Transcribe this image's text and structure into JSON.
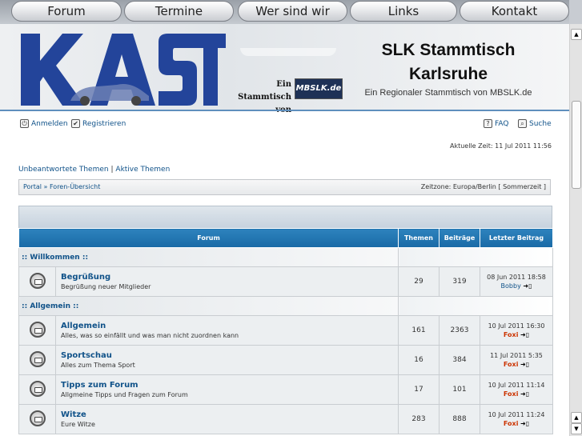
{
  "nav": {
    "tabs": [
      "Forum",
      "Termine",
      "Wer sind wir",
      "Links",
      "Kontakt"
    ]
  },
  "header": {
    "logo_text": "KAST",
    "logo_sub_line1": "Ein Stammtisch",
    "logo_sub_line2": "von",
    "mbslk_text": "MBSLK.de",
    "title_line1": "SLK Stammtisch",
    "title_line2": "Karlsruhe",
    "description": "Ein Regionaler Stammtisch von MBSLK.de"
  },
  "account": {
    "login": "Anmelden",
    "register": "Registrieren",
    "faq": "FAQ",
    "search": "Suche",
    "current_time": "Aktuelle Zeit: 11 Jul 2011 11:56"
  },
  "quicklinks": {
    "unanswered": "Unbeantwortete Themen",
    "separator": "|",
    "active": "Aktive Themen"
  },
  "breadcrumb": {
    "portal": "Portal",
    "arrow": "»",
    "index": "Foren-Übersicht",
    "timezone": "Zeitzone: Europa/Berlin [ Sommerzeit ]"
  },
  "table": {
    "headers": [
      "Forum",
      "Themen",
      "Beiträge",
      "Letzter Beitrag"
    ],
    "categories": [
      {
        "name": ":: Willkommen ::",
        "forums": [
          {
            "name": "Begrüßung",
            "desc": "Begrüßung neuer Mitglieder",
            "topics": "29",
            "posts": "319",
            "last_date": "08 Jun 2011 18:58",
            "last_user": "Bobby",
            "user_style": "normal"
          }
        ]
      },
      {
        "name": ":: Allgemein ::",
        "forums": [
          {
            "name": "Allgemein",
            "desc": "Alles, was so einfällt und was man nicht zuordnen kann",
            "topics": "161",
            "posts": "2363",
            "last_date": "10 Jul 2011 16:30",
            "last_user": "Foxi",
            "user_style": "red"
          },
          {
            "name": "Sportschau",
            "desc": "Alles zum Thema Sport",
            "topics": "16",
            "posts": "384",
            "last_date": "11 Jul 2011 5:35",
            "last_user": "Foxi",
            "user_style": "red"
          },
          {
            "name": "Tipps zum Forum",
            "desc": "Allgmeine Tipps und Fragen zum Forum",
            "topics": "17",
            "posts": "101",
            "last_date": "10 Jul 2011 11:14",
            "last_user": "Foxi",
            "user_style": "red"
          },
          {
            "name": "Witze",
            "desc": "Eure Witze",
            "topics": "283",
            "posts": "888",
            "last_date": "10 Jul 2011 11:24",
            "last_user": "Foxi",
            "user_style": "red"
          }
        ]
      }
    ]
  },
  "colors": {
    "link": "#105289",
    "header_blue": "#196aa6",
    "admin_red": "#cc3300"
  }
}
